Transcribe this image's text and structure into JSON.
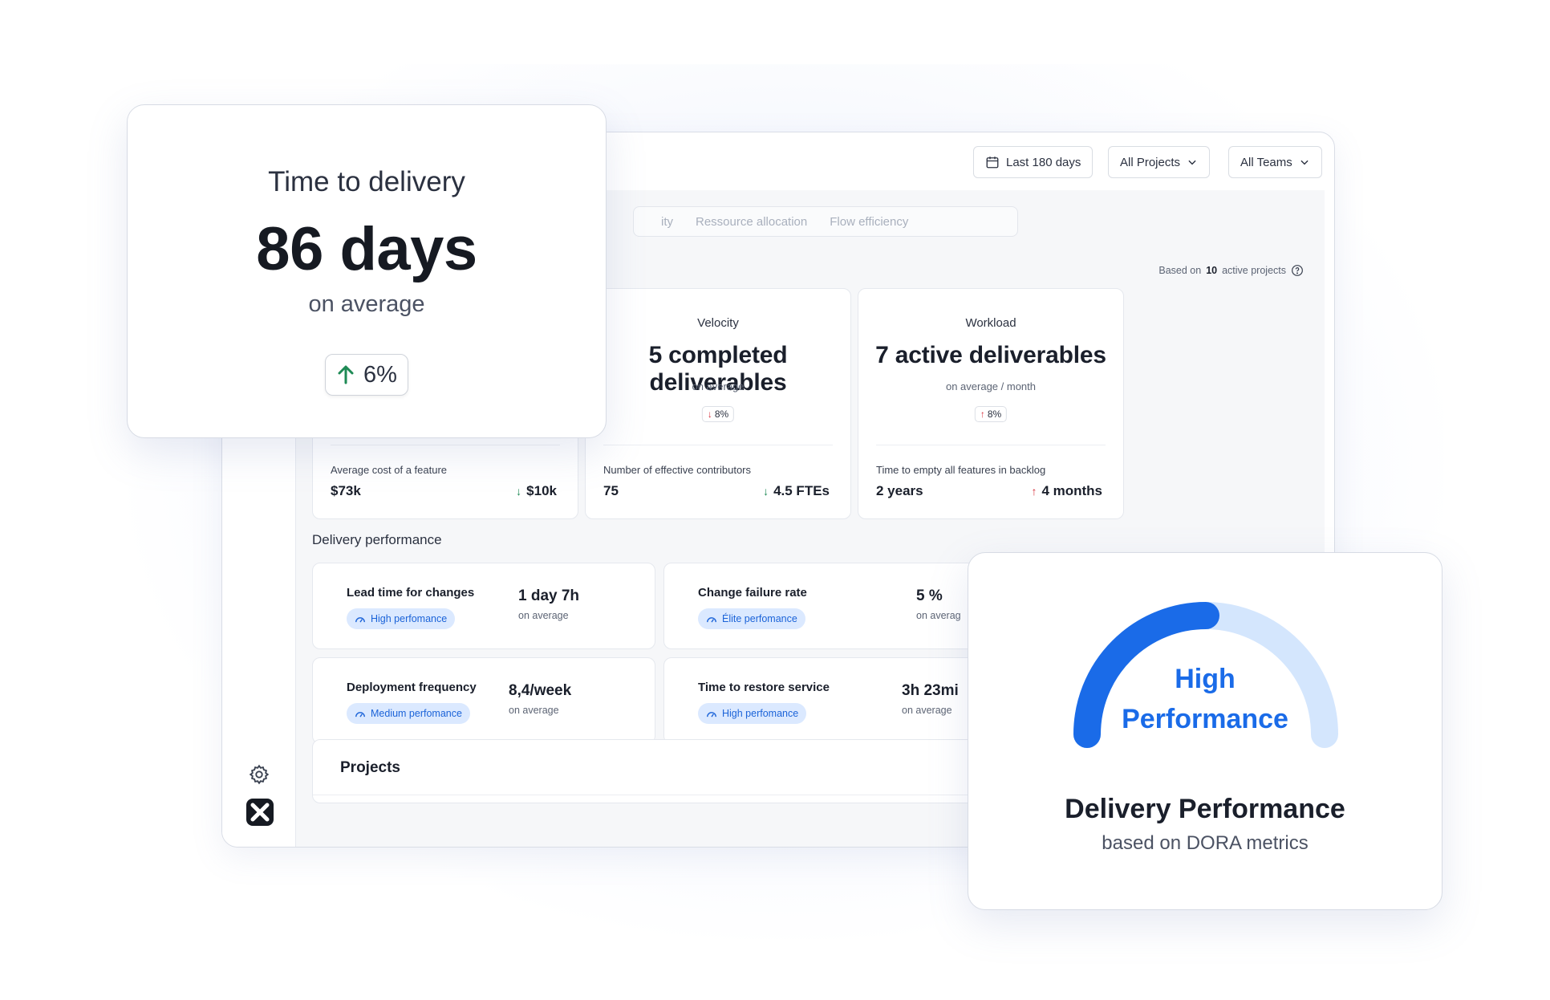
{
  "filters": {
    "date_range": "Last 180 days",
    "projects": "All Projects",
    "teams": "All Teams"
  },
  "tabs": [
    "ity",
    "Ressource allocation",
    "Flow efficiency"
  ],
  "based_on": {
    "prefix": "Based on",
    "count": "10",
    "suffix": "active projects"
  },
  "kpis": [
    {
      "title": "",
      "value": "",
      "sub": "",
      "delta": "",
      "footer_label": "Average cost of a feature",
      "footer_value": "$73k",
      "footer_delta": "$10k",
      "footer_direction": "down"
    },
    {
      "title": "Velocity",
      "value": "5 completed deliverables",
      "sub": "on average",
      "delta": "8%",
      "delta_direction": "down",
      "footer_label": "Number of effective contributors",
      "footer_value": "75",
      "footer_delta": "4.5 FTEs",
      "footer_direction": "down"
    },
    {
      "title": "Workload",
      "value": "7 active deliverables",
      "sub": "on average / month",
      "delta": "8%",
      "delta_direction": "up",
      "footer_label": "Time to empty all features in backlog",
      "footer_value": "2 years",
      "footer_delta": "4 months",
      "footer_direction": "up"
    }
  ],
  "delivery_section_title": "Delivery performance",
  "dora": [
    {
      "name": "Lead time for changes",
      "badge": "High perfomance",
      "value": "1 day 7h",
      "sub": "on average"
    },
    {
      "name": "Change failure rate",
      "badge": "Élite perfomance",
      "value": "5 %",
      "sub": "on averag"
    },
    {
      "name": "Deployment frequency",
      "badge": "Medium perfomance",
      "value": "8,4/week",
      "sub": "on average"
    },
    {
      "name": "Time to restore service",
      "badge": "High perfomance",
      "value": "3h 23mi",
      "sub": "on average"
    }
  ],
  "projects_title": "Projects",
  "ttd_card": {
    "title": "Time to delivery",
    "value": "86 days",
    "sub": "on average",
    "delta": "6%",
    "delta_direction": "up"
  },
  "dp_card": {
    "gauge_label_line1": "High",
    "gauge_label_line2": "Performance",
    "gauge_level": 0.5,
    "title": "Delivery Performance",
    "subtitle": "based on DORA metrics"
  },
  "colors": {
    "accent": "#1a6be8",
    "gauge_track": "#d4e6fd",
    "badge_bg": "#dbe9ff",
    "positive": "#1e8a55",
    "negative": "#d6303b"
  }
}
